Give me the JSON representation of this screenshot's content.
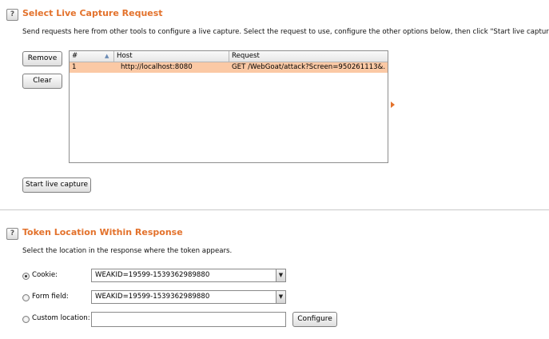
{
  "capture": {
    "help": "?",
    "title": "Select Live Capture Request",
    "description": "Send requests here from other tools to configure a live capture. Select the request to use, configure the other options below, then click \"Start live capture\".",
    "remove_label": "Remove",
    "clear_label": "Clear",
    "start_label": "Start live capture",
    "columns": [
      "#",
      "Host",
      "Request"
    ],
    "rows": [
      {
        "num": "1",
        "host": "http://localhost:8080",
        "request": "GET /WebGoat/attack?Screen=950261113&..."
      }
    ]
  },
  "token": {
    "help": "?",
    "title": "Token Location Within Response",
    "description": "Select the location in the response where the token appears.",
    "cookie_label": "Cookie:",
    "cookie_value": "WEAKID=19599-1539362989880",
    "form_label": "Form field:",
    "form_value": "WEAKID=19599-1539362989880",
    "custom_label": "Custom location:",
    "custom_value": "",
    "configure_label": "Configure",
    "selected": "cookie"
  },
  "colors": {
    "accent": "#e3722c",
    "selected_row": "#fbc9a5"
  },
  "icons": {
    "help": "help-icon",
    "sort": "sort-asc-icon",
    "expand": "triangle-right-icon",
    "dropdown": "dropdown-arrow-icon"
  }
}
